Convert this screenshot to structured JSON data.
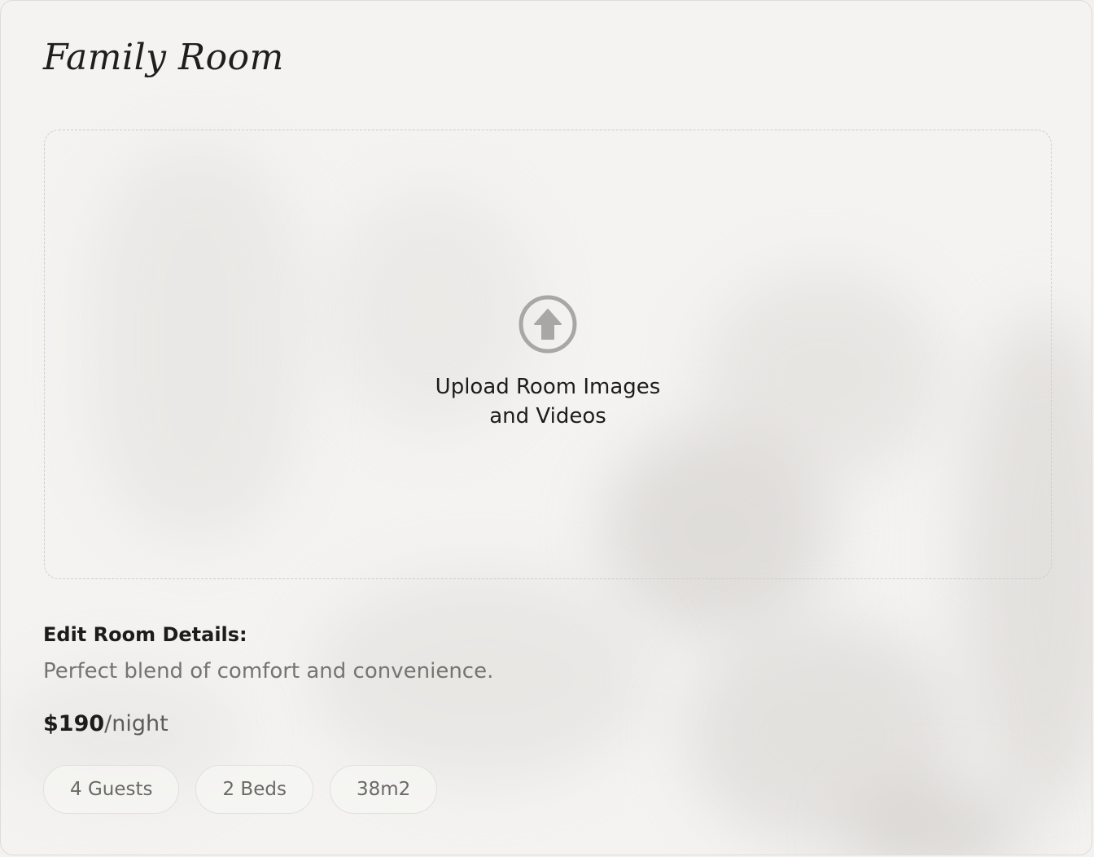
{
  "room": {
    "title": "Family Room"
  },
  "upload": {
    "icon": "upload-arrow-circle-icon",
    "line1": "Upload Room Images",
    "line2": "and Videos"
  },
  "details": {
    "heading": "Edit Room Details:",
    "description": "Perfect blend of comfort and convenience.",
    "price": "$190",
    "price_unit": "/night",
    "tags": [
      {
        "label": "4 Guests"
      },
      {
        "label": "2 Beds"
      },
      {
        "label": "38m2"
      }
    ]
  },
  "colors": {
    "background": "#f4f3f1",
    "text": "#1c1c1c",
    "muted_text": "#767471",
    "icon": "#a9a7a4",
    "border": "#cfcdc9"
  }
}
